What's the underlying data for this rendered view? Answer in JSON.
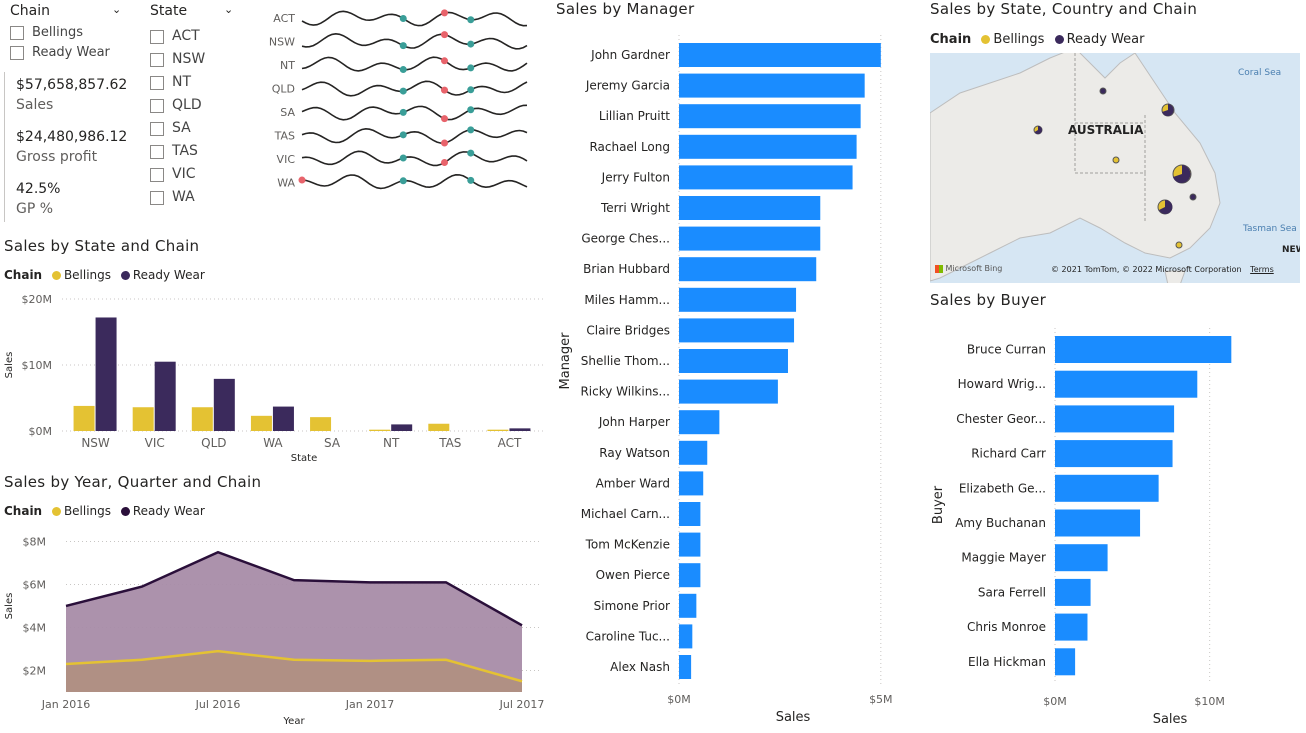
{
  "colors": {
    "bellings": "#E4C233",
    "ready_wear": "#3B2A5C",
    "ready_wear_line": "#2A0F3A",
    "bar": "#1A8CFF",
    "area": "#A88CA8",
    "area_low": "#B09080",
    "spark_high": "#3A9E98",
    "spark_low": "#E8636B"
  },
  "slicer_chain": {
    "title": "Chain",
    "items": [
      "Bellings",
      "Ready Wear"
    ]
  },
  "slicer_state": {
    "title": "State",
    "items": [
      "ACT",
      "NSW",
      "NT",
      "QLD",
      "SA",
      "TAS",
      "VIC",
      "WA"
    ]
  },
  "kpi": {
    "sales_value": "$57,658,857.62",
    "sales_label": "Sales",
    "gp_value": "$24,480,986.12",
    "gp_label": "Gross profit",
    "gpp_value": "42.5%",
    "gpp_label": "GP %"
  },
  "sparklines": {
    "states": [
      "ACT",
      "NSW",
      "NT",
      "QLD",
      "SA",
      "TAS",
      "VIC",
      "WA"
    ]
  },
  "state_chain": {
    "title": "Sales by State and Chain",
    "legend_title": "Chain",
    "legend": [
      "Bellings",
      "Ready Wear"
    ],
    "yticks": [
      "$20M",
      "$10M",
      "$0M"
    ],
    "ylabel": "Sales",
    "xlabel": "State"
  },
  "quarter_chain": {
    "title": "Sales by Year, Quarter and Chain",
    "legend_title": "Chain",
    "legend": [
      "Bellings",
      "Ready Wear"
    ],
    "yticks": [
      "$8M",
      "$6M",
      "$4M",
      "$2M"
    ],
    "xticks": [
      "Jan 2016",
      "Jul 2016",
      "Jan 2017",
      "Jul 2017"
    ],
    "ylabel": "Sales",
    "xlabel": "Year"
  },
  "manager": {
    "title": "Sales by Manager",
    "ylabel": "Manager",
    "xlabel": "Sales",
    "xticks": [
      "$0M",
      "$5M"
    ]
  },
  "map": {
    "title": "Sales by State, Country and Chain",
    "legend_title": "Chain",
    "legend": [
      "Bellings",
      "Ready Wear"
    ],
    "country": "AUSTRALIA",
    "coral": "Coral Sea",
    "tasman": "Tasman Sea",
    "ne": "NEW",
    "bing": "Microsoft Bing",
    "copyright": "© 2021 TomTom, © 2022 Microsoft Corporation",
    "terms": "Terms"
  },
  "buyer": {
    "title": "Sales by Buyer",
    "ylabel": "Buyer",
    "xlabel": "Sales",
    "xticks": [
      "$0M",
      "$10M"
    ]
  },
  "chart_data": [
    {
      "type": "bar",
      "title": "Sales by State and Chain",
      "categories": [
        "NSW",
        "VIC",
        "QLD",
        "WA",
        "SA",
        "NT",
        "TAS",
        "ACT"
      ],
      "series": [
        {
          "name": "Bellings",
          "values": [
            3.8,
            3.6,
            3.6,
            2.3,
            2.1,
            0.2,
            1.1,
            0.2
          ]
        },
        {
          "name": "Ready Wear",
          "values": [
            17.2,
            10.5,
            7.9,
            3.7,
            0,
            1.0,
            0,
            0.4
          ]
        }
      ],
      "xlabel": "State",
      "ylabel": "Sales",
      "ylim": [
        0,
        20
      ],
      "unit": "$M",
      "legend": "top-left",
      "grid": true
    },
    {
      "type": "area",
      "title": "Sales by Year, Quarter and Chain",
      "x": [
        "2016-Q1",
        "2016-Q2",
        "2016-Q3",
        "2016-Q4",
        "2017-Q1",
        "2017-Q2",
        "2017-Q3"
      ],
      "series": [
        {
          "name": "Bellings",
          "values": [
            2.3,
            2.5,
            2.9,
            2.5,
            2.45,
            2.5,
            1.5
          ]
        },
        {
          "name": "Ready Wear",
          "values": [
            5.0,
            5.9,
            7.5,
            6.2,
            6.1,
            6.1,
            4.1
          ]
        }
      ],
      "xlabel": "Year",
      "ylabel": "Sales",
      "ylim": [
        1,
        8.3
      ],
      "unit": "$M",
      "legend": "top-left",
      "grid": true
    },
    {
      "type": "bar",
      "orientation": "horizontal",
      "title": "Sales by Manager",
      "categories": [
        "John Gardner",
        "Jeremy Garcia",
        "Lillian Pruitt",
        "Rachael Long",
        "Jerry Fulton",
        "Terri Wright",
        "George Ches...",
        "Brian Hubbard",
        "Miles Hamm...",
        "Claire Bridges",
        "Shellie Thom...",
        "Ricky Wilkins...",
        "John Harper",
        "Ray Watson",
        "Amber Ward",
        "Michael Carn...",
        "Tom McKenzie",
        "Owen Pierce",
        "Simone Prior",
        "Caroline Tuc...",
        "Alex Nash"
      ],
      "values": [
        5.0,
        4.6,
        4.5,
        4.4,
        4.3,
        3.5,
        3.5,
        3.4,
        2.9,
        2.85,
        2.7,
        2.45,
        1.0,
        0.7,
        0.6,
        0.53,
        0.53,
        0.53,
        0.43,
        0.33,
        0.3
      ],
      "xlabel": "Sales",
      "ylabel": "Manager",
      "xlim": [
        0,
        5.5
      ],
      "unit": "$M"
    },
    {
      "type": "bar",
      "orientation": "horizontal",
      "title": "Sales by Buyer",
      "categories": [
        "Bruce Curran",
        "Howard Wrig...",
        "Chester Geor...",
        "Richard Carr",
        "Elizabeth Ge...",
        "Amy Buchanan",
        "Maggie Mayer",
        "Sara Ferrell",
        "Chris Monroe",
        "Ella Hickman"
      ],
      "values": [
        11.4,
        9.2,
        7.7,
        7.6,
        6.7,
        5.5,
        3.4,
        2.3,
        2.1,
        1.3
      ],
      "xlabel": "Sales",
      "ylabel": "Buyer",
      "xlim": [
        0,
        15
      ],
      "unit": "$M"
    }
  ]
}
